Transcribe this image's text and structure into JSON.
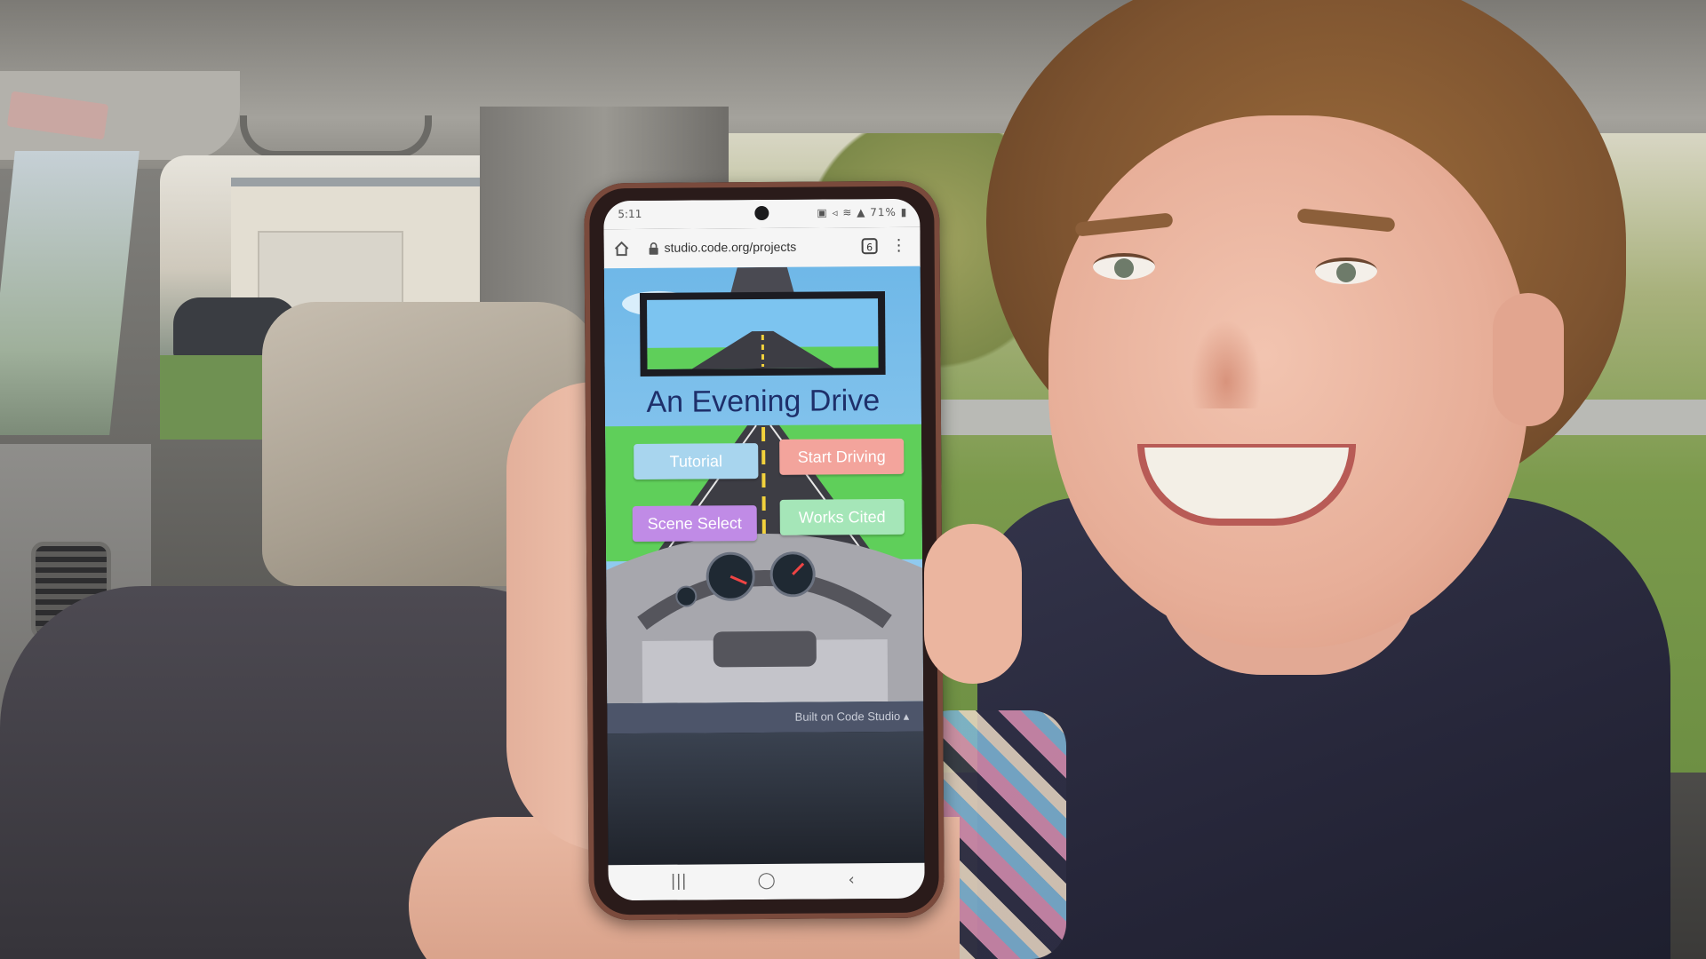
{
  "phone": {
    "status_bar": {
      "time": "5:11",
      "icons": "▣ ◃ ≋ ▲ 71% ▮"
    },
    "browser": {
      "url": "studio.code.org/projects",
      "tab_count": "6",
      "menu_glyph": "⋮"
    },
    "app": {
      "title": "An Evening Drive",
      "buttons": {
        "tutorial": "Tutorial",
        "start_driving": "Start Driving",
        "scene_select": "Scene Select",
        "works_cited": "Works Cited"
      },
      "footer": "Built on Code Studio ▴",
      "colors": {
        "sky": "#6fb8e8",
        "grass": "#5fcf5a",
        "road": "#3d3d44",
        "title": "#1e2f6a",
        "tutorial": "#a8d5ee",
        "start_driving": "#f3a49c",
        "scene_select": "#c08be6",
        "works_cited": "#a5e6b8"
      }
    },
    "nav": {
      "recent": "|||",
      "home": "◯",
      "back": "‹"
    }
  },
  "icons": {
    "home": "home-icon",
    "lock": "lock-icon",
    "tabs": "tabs-icon",
    "menu": "menu-icon"
  }
}
